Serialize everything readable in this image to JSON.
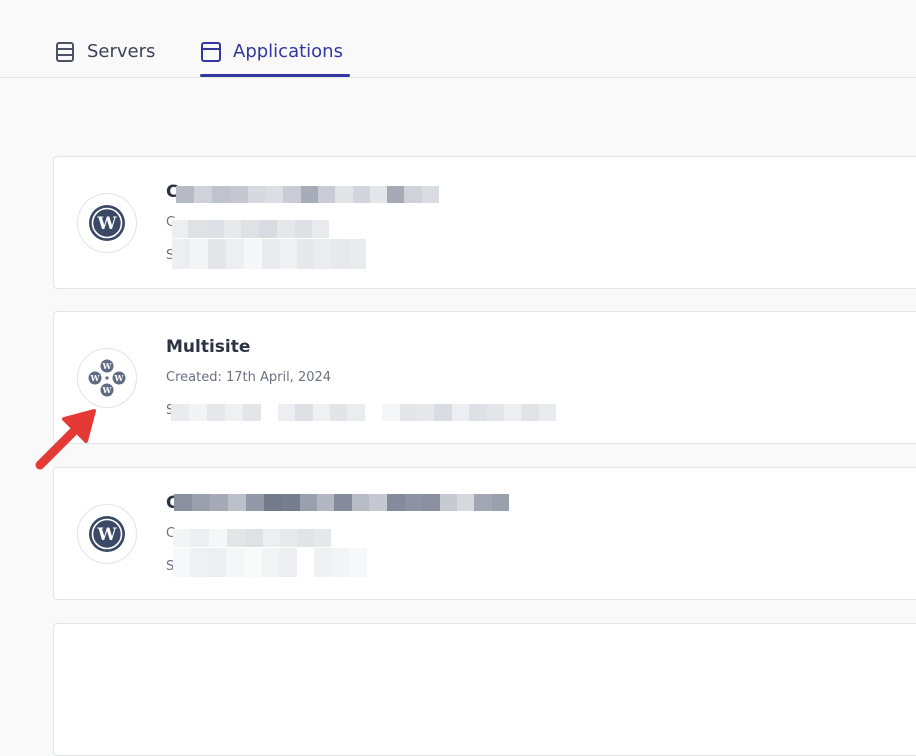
{
  "tabs": [
    {
      "label": "Servers",
      "icon": "server-icon",
      "active": false
    },
    {
      "label": "Applications",
      "icon": "window-icon",
      "active": true
    }
  ],
  "colors": {
    "accent": "#3137a0",
    "wp_logo": "#3a4a66",
    "arrow": "#ef4444"
  },
  "applications": [
    {
      "icon": "wordpress-icon",
      "name": "C",
      "created": "C",
      "server": "S"
    },
    {
      "icon": "wordpress-multisite-icon",
      "name": "Multisite",
      "created": "Created: 17th April, 2024",
      "server": "S"
    },
    {
      "icon": "wordpress-icon",
      "name": "C",
      "created": "C",
      "server": "S"
    }
  ]
}
